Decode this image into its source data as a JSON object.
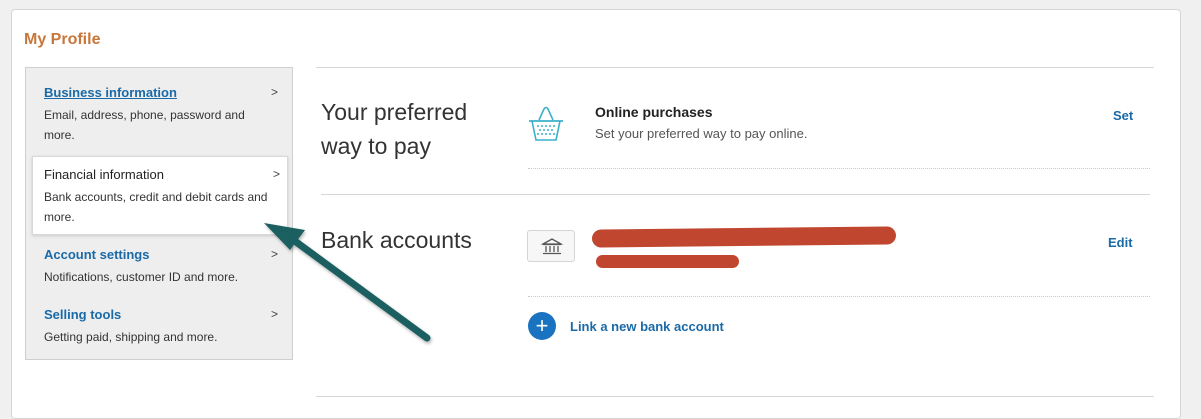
{
  "page": {
    "title": "My Profile"
  },
  "sidebar": {
    "items": [
      {
        "label": "Business information",
        "desc": "Email, address, phone, password and more.",
        "chevron": ">"
      },
      {
        "label": "Financial information",
        "desc": "Bank accounts, credit and debit cards and more.",
        "chevron": ">"
      },
      {
        "label": "Account settings",
        "desc": "Notifications, customer ID and more.",
        "chevron": ">"
      },
      {
        "label": "Selling tools",
        "desc": "Getting paid, shipping and more.",
        "chevron": ">"
      }
    ]
  },
  "preferred": {
    "title_line1": "Your preferred",
    "title_line2": "way to pay",
    "icon": "shopping-basket-icon",
    "online_title": "Online purchases",
    "online_desc": "Set your preferred way to pay online.",
    "action": "Set"
  },
  "bank": {
    "title": "Bank accounts",
    "icon": "bank-icon",
    "action": "Edit",
    "link_label": "Link a new bank account",
    "link_icon": "plus-icon"
  },
  "colors": {
    "title_orange": "#c8763a",
    "link_blue": "#1a6aa7",
    "plus_blue": "#1a73c0",
    "basket_teal": "#3bb1c9",
    "arrow_teal": "#1f5e61",
    "redaction": "#c0462f"
  }
}
